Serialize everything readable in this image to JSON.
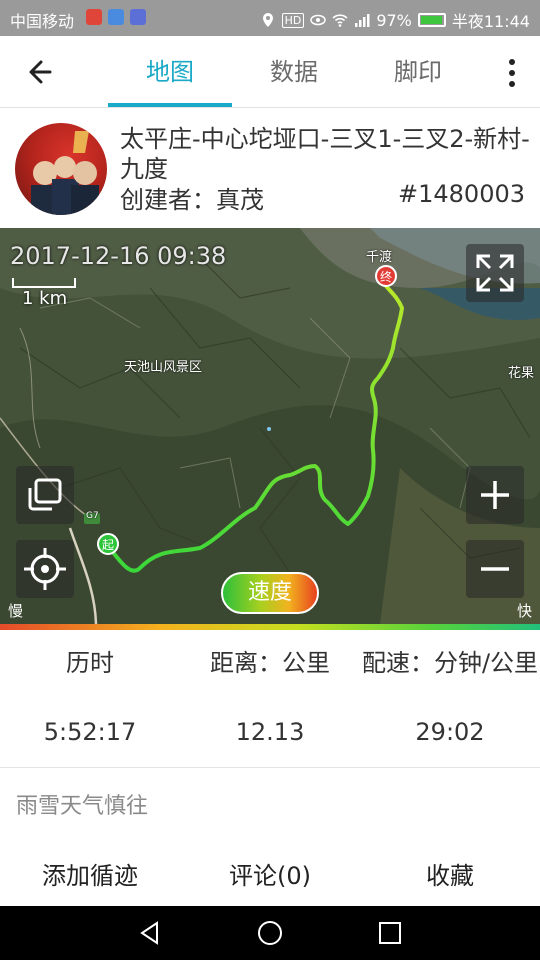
{
  "status_bar": {
    "carrier": "中国移动",
    "battery": "97%",
    "time": "半夜11:44",
    "hd": "HD",
    "notification_icons": [
      "video-app-icon",
      "app-icon",
      "camera-app-icon"
    ],
    "indicator_icons": [
      "location-icon",
      "eye-icon",
      "wifi-icon",
      "signal-icon"
    ]
  },
  "toolbar": {
    "back_icon": "arrow-left-icon",
    "tabs": [
      {
        "label": "地图",
        "active": true
      },
      {
        "label": "数据",
        "active": false
      },
      {
        "label": "脚印",
        "active": false
      }
    ],
    "more_icon": "more-vertical-icon",
    "accent": "#1aa9c7"
  },
  "track": {
    "title": "太平庄-中心坨垭口-三叉1-三叉2-新村-九度",
    "creator": "创建者：真茂",
    "id": "#1480003"
  },
  "map": {
    "timestamp": "2017-12-16 09:38",
    "scale": "1 km",
    "places": [
      "天池山风景区",
      "千渡",
      "花果",
      "G7"
    ],
    "start_marker": "起",
    "end_marker": "终",
    "speed_button": "速度",
    "slow_label": "慢",
    "fast_label": "快",
    "controls": [
      "fullscreen-icon",
      "layers-icon",
      "locate-icon",
      "zoom-in-icon",
      "zoom-out-icon"
    ]
  },
  "stats": [
    {
      "label": "历时",
      "value": "5:52:17"
    },
    {
      "label": "距离：公里",
      "value": "12.13"
    },
    {
      "label": "配速：分钟/公里",
      "value": "29:02"
    }
  ],
  "note": "雨雪天气慎往",
  "actions": [
    "添加循迹",
    "评论(0)",
    "收藏"
  ],
  "navbar": [
    "back-triangle-icon",
    "home-circle-icon",
    "recents-square-icon"
  ]
}
